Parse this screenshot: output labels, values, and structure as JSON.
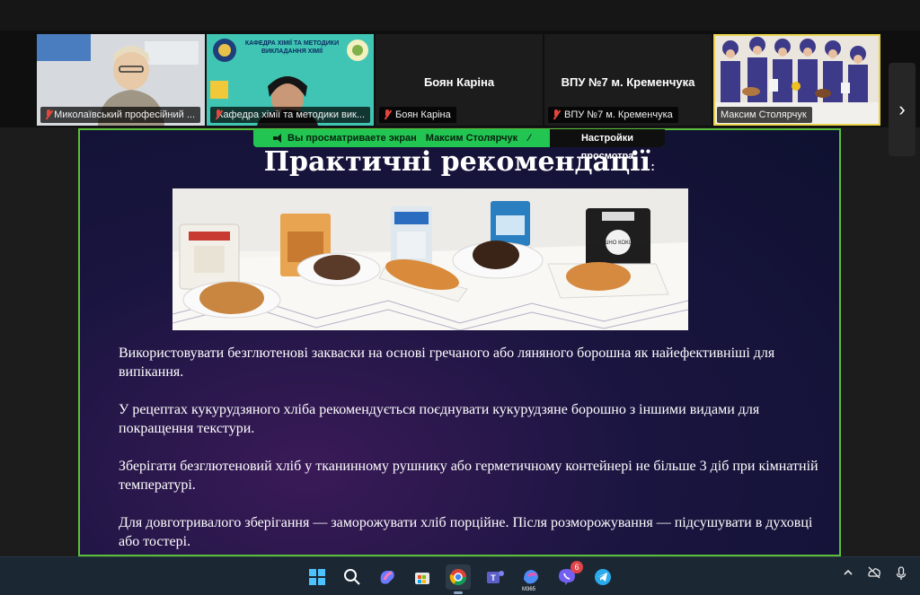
{
  "participants": [
    {
      "name": "Миколаївський професійний ...",
      "muted": true
    },
    {
      "name": "Кафедра хімії та методики вик...",
      "muted": true,
      "logo_text": "КАФЕДРА ХІМІЇ ТА МЕТОДИКИ ВИКЛАДАННЯ ХІМІЇ"
    },
    {
      "name": "Боян Каріна",
      "muted": true,
      "display_name": "Боян Каріна"
    },
    {
      "name": "ВПУ №7 м. Кременчука",
      "muted": true,
      "display_name": "ВПУ №7 м. Кременчука"
    },
    {
      "name": "Максим Столярчук",
      "muted": false
    }
  ],
  "share_banner": {
    "viewing_text": "Вы просматриваете экран",
    "presenter": "Максим Столярчук",
    "options_label": "Настройки просмотра"
  },
  "slide": {
    "title": "Практичні рекомендації",
    "title_suffix": ":",
    "paragraphs": [
      "Використовувати безглютенові закваски на основі гречаного або ляняного борошна як найефективніші для випікання.",
      "У рецептах кукурудзяного хліба рекомендується поєднувати кукурудзяне борошно з іншими видами для покращення текстури.",
      "Зберігати безглютеновий хліб у тканинному рушнику або герметичному контейнері не більше 3 діб при кімнатній температурі.",
      "Для довготривалого зберігання — заморожувати хліб порційне. Після розморожування — підсушувати в духовці або тостері."
    ],
    "photo_package_text": "БОРОШНО КОКОСОВЕ"
  },
  "taskbar": {
    "icons": [
      "windows-start-icon",
      "search-icon",
      "copilot-icon",
      "store-icon",
      "chrome-icon",
      "teams-icon",
      "m365-icon",
      "viber-icon",
      "telegram-icon"
    ],
    "viber_badge": "6",
    "m365_label": "M365"
  },
  "colors": {
    "share_green": "#23c552",
    "slide_border": "#5ac03a",
    "mute_red": "#e5463c"
  }
}
